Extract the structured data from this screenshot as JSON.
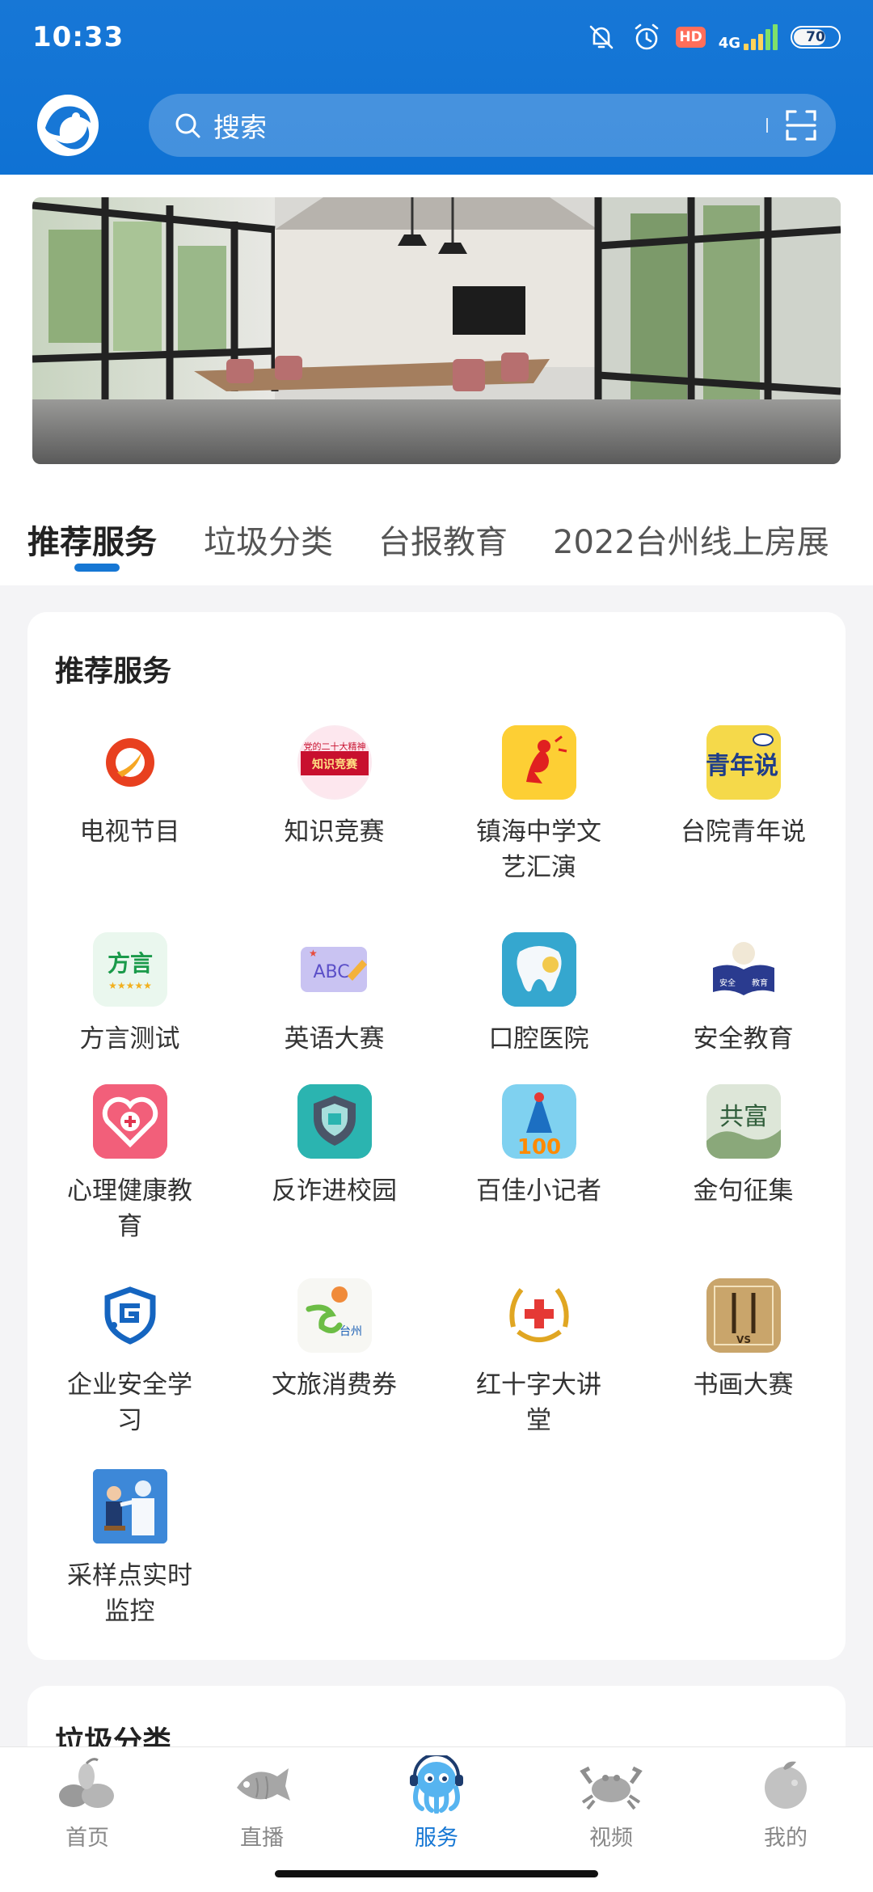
{
  "status_bar": {
    "time": "10:33",
    "hd": "HD",
    "network": "4G",
    "battery": "70"
  },
  "search": {
    "placeholder": "搜索"
  },
  "tabs": [
    {
      "label": "推荐服务",
      "active": true
    },
    {
      "label": "垃圾分类",
      "active": false
    },
    {
      "label": "台报教育",
      "active": false
    },
    {
      "label": "2022台州线上房展",
      "active": false
    }
  ],
  "section": {
    "title": "推荐服务",
    "items": [
      {
        "label": "电视节目",
        "icon": "tv-program-icon"
      },
      {
        "label": "知识竞赛",
        "icon": "knowledge-contest-icon",
        "badge_top": "党的二十大精神",
        "badge_main": "知识竞赛"
      },
      {
        "label": "镇海中学文艺汇演",
        "icon": "art-performance-icon"
      },
      {
        "label": "台院青年说",
        "icon": "youth-talk-icon",
        "badge_main": "青年说"
      },
      {
        "label": "方言测试",
        "icon": "dialect-test-icon",
        "badge_main": "方言"
      },
      {
        "label": "英语大赛",
        "icon": "english-contest-icon",
        "badge_main": "ABC"
      },
      {
        "label": "口腔医院",
        "icon": "dental-hospital-icon"
      },
      {
        "label": "安全教育",
        "icon": "safety-education-icon",
        "badge_left": "安全",
        "badge_right": "教育"
      },
      {
        "label": "心理健康教育",
        "icon": "mental-health-icon"
      },
      {
        "label": "反诈进校园",
        "icon": "anti-fraud-icon"
      },
      {
        "label": "百佳小记者",
        "icon": "young-reporter-icon",
        "badge_main": "100"
      },
      {
        "label": "金句征集",
        "icon": "golden-quote-icon",
        "badge_main": "共富"
      },
      {
        "label": "企业安全学习",
        "icon": "enterprise-safety-icon"
      },
      {
        "label": "文旅消费券",
        "icon": "tourism-voucher-icon",
        "badge_main": "台州"
      },
      {
        "label": "红十字大讲堂",
        "icon": "red-cross-icon"
      },
      {
        "label": "书画大赛",
        "icon": "calligraphy-contest-icon",
        "badge_main": "VS"
      },
      {
        "label": "采样点实时监控",
        "icon": "sampling-monitor-icon"
      }
    ]
  },
  "section2": {
    "title": "垃圾分类"
  },
  "bottom_nav": [
    {
      "label": "首页",
      "active": false
    },
    {
      "label": "直播",
      "active": false
    },
    {
      "label": "服务",
      "active": true
    },
    {
      "label": "视频",
      "active": false
    },
    {
      "label": "我的",
      "active": false
    }
  ],
  "colors": {
    "primary": "#1677d4",
    "header": "#1777d6",
    "text": "#333333",
    "background": "#f4f4f6"
  }
}
